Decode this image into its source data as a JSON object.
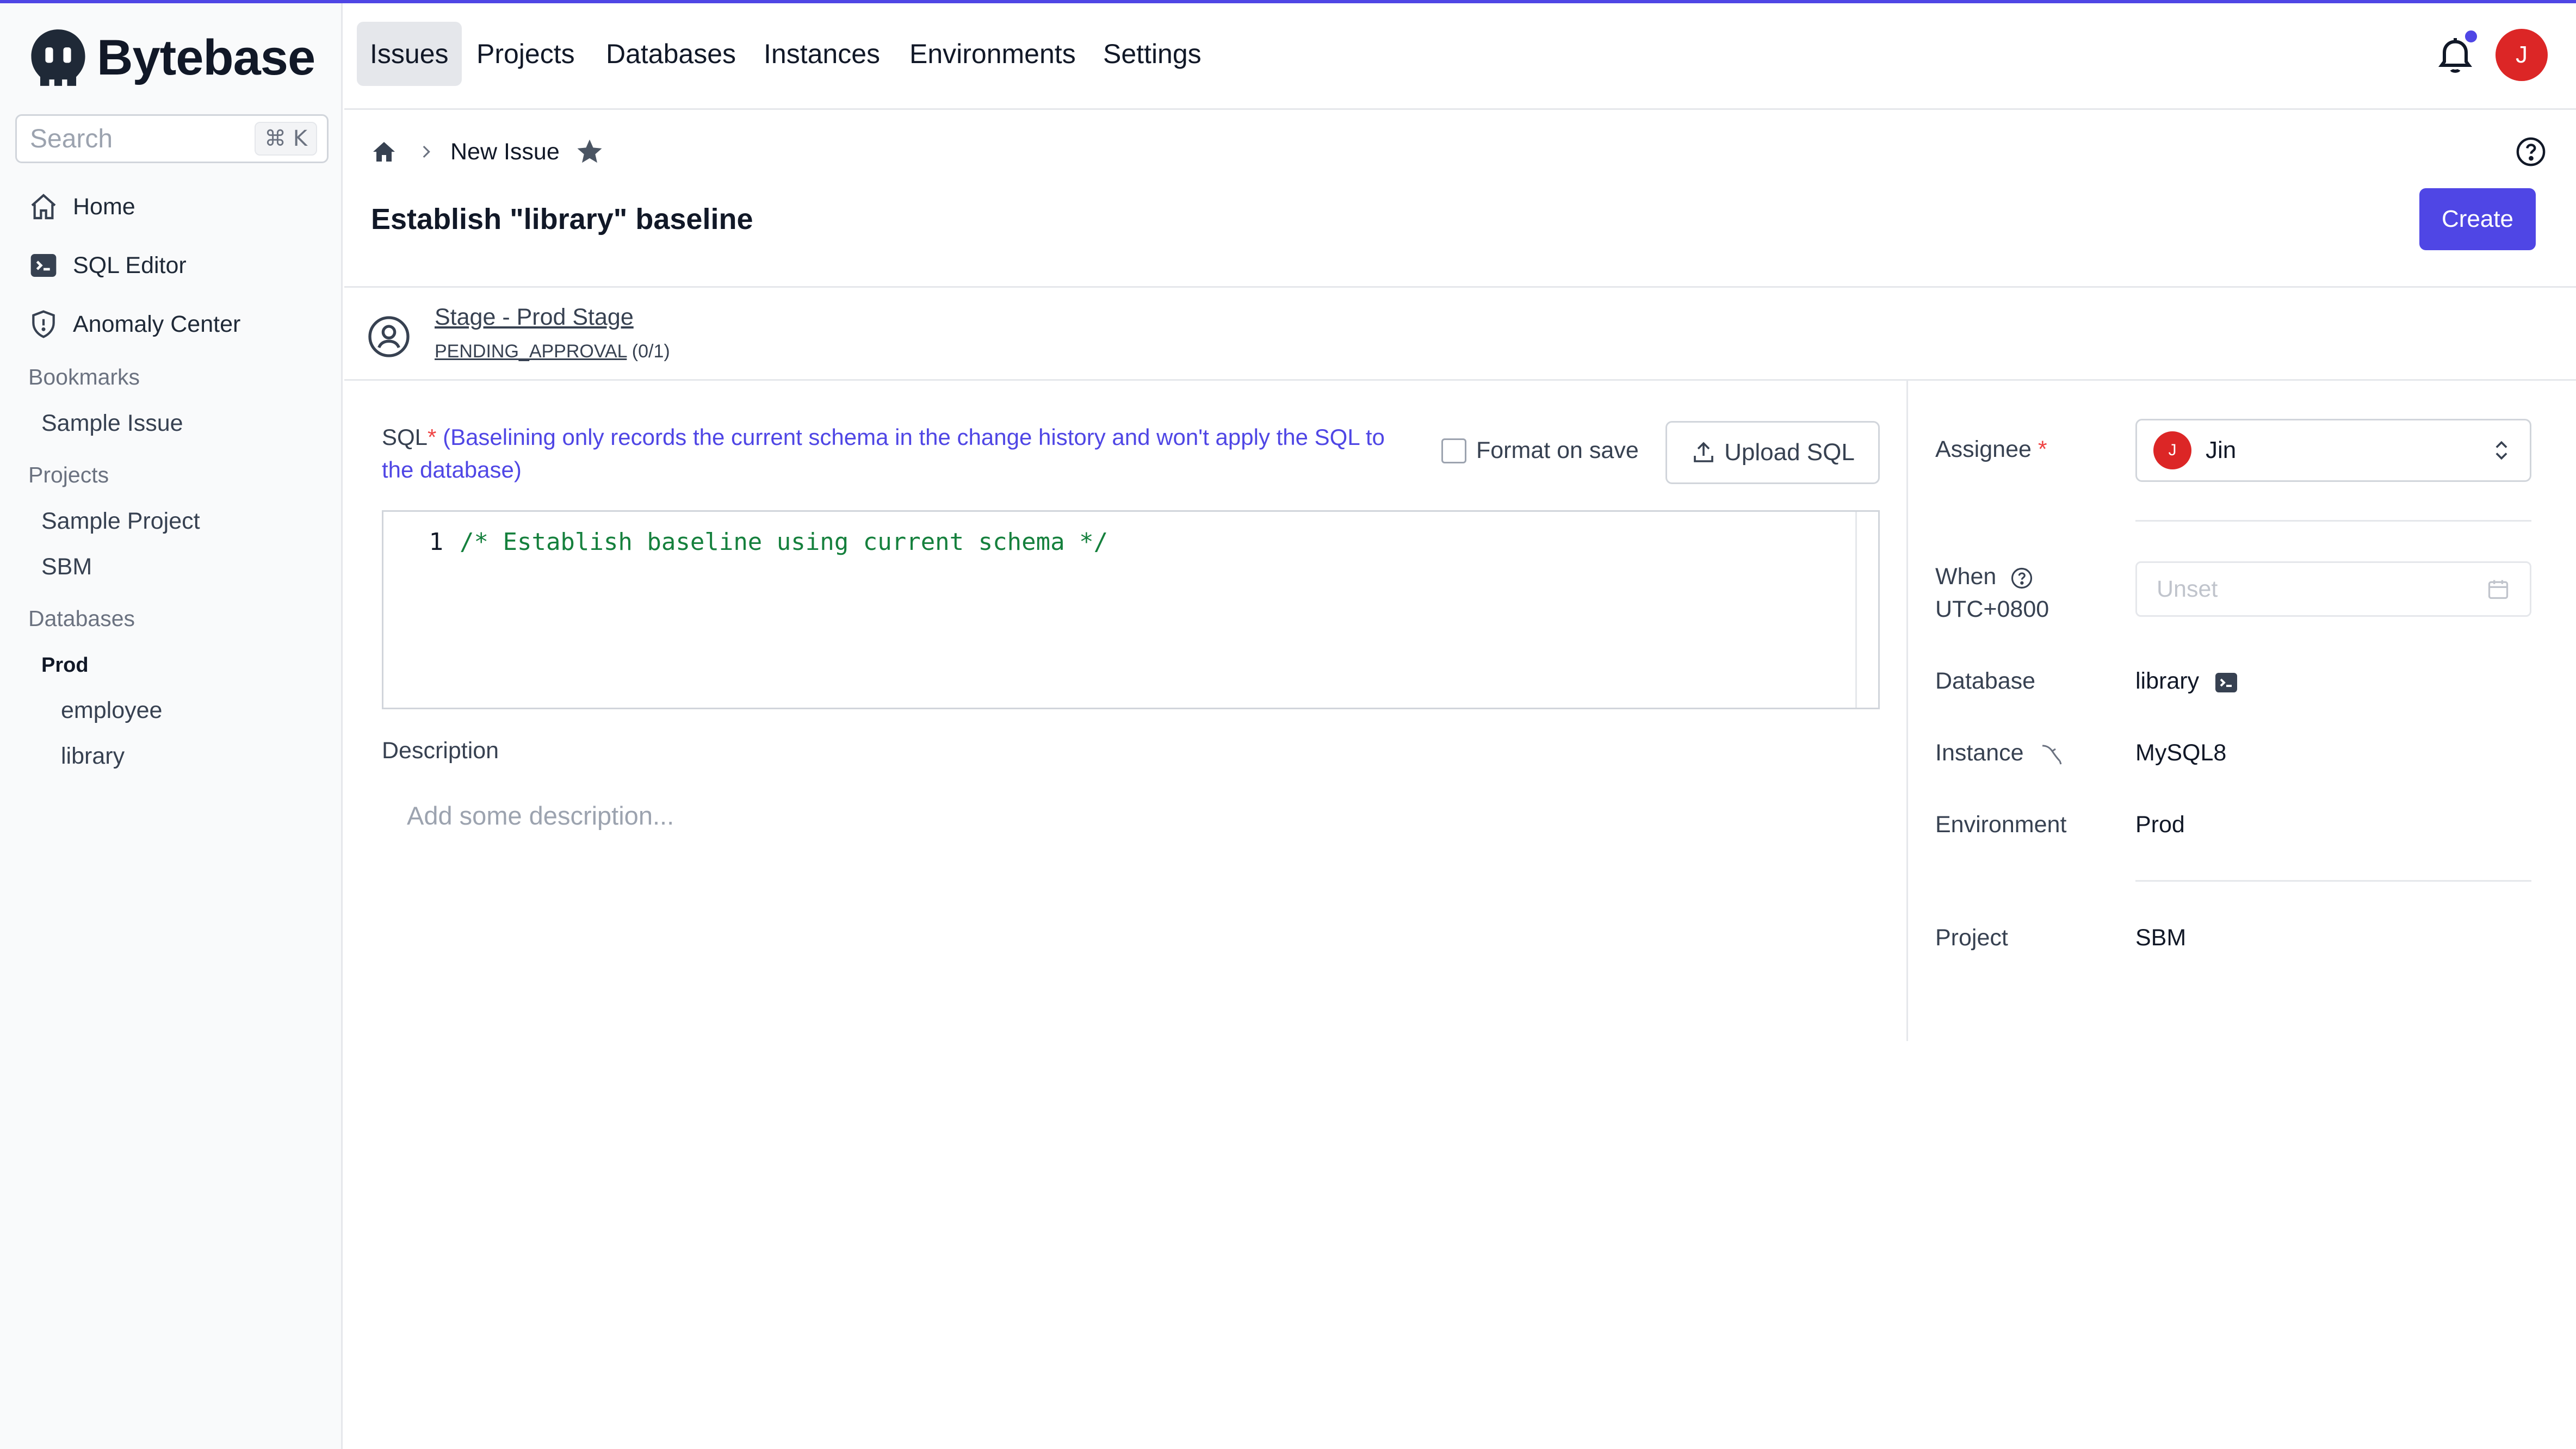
{
  "app": {
    "name": "Bytebase"
  },
  "colors": {
    "accent": "#4f46e5",
    "avatar": "#dc2626",
    "code": "#15803d"
  },
  "search": {
    "placeholder": "Search",
    "shortcut": "⌘ K"
  },
  "sidebar": {
    "nav": [
      {
        "label": "Home",
        "icon": "home-icon"
      },
      {
        "label": "SQL Editor",
        "icon": "terminal-icon"
      },
      {
        "label": "Anomaly Center",
        "icon": "shield-icon"
      }
    ],
    "bookmarks": {
      "title": "Bookmarks",
      "items": [
        "Sample Issue"
      ]
    },
    "projects": {
      "title": "Projects",
      "items": [
        "Sample Project",
        "SBM"
      ]
    },
    "databases": {
      "title": "Databases",
      "env": "Prod",
      "items": [
        "employee",
        "library"
      ]
    }
  },
  "topnav": {
    "tabs": [
      "Issues",
      "Projects",
      "Databases",
      "Instances",
      "Environments",
      "Settings"
    ],
    "active": "Issues",
    "user_initial": "J"
  },
  "breadcrumb": {
    "current": "New Issue"
  },
  "page": {
    "title": "Establish \"library\" baseline",
    "create_label": "Create"
  },
  "stage": {
    "name": "Stage - Prod Stage",
    "status": "PENDING_APPROVAL",
    "progress": "(0/1)"
  },
  "sql": {
    "label": "SQL",
    "required_mark": "*",
    "hint": "(Baselining only records the current schema in the change history and won't apply the SQL to the database)",
    "format_on_save_label": "Format on save",
    "format_on_save": false,
    "upload_label": "Upload SQL",
    "line_number": "1",
    "code": "/* Establish baseline using current schema */"
  },
  "description": {
    "label": "Description",
    "placeholder": "Add some description..."
  },
  "panel": {
    "assignee_label": "Assignee",
    "required_mark": "*",
    "assignee_initial": "J",
    "assignee_name": "Jin",
    "when_label": "When",
    "when_tz": "UTC+0800",
    "when_placeholder": "Unset",
    "database_label": "Database",
    "database_value": "library",
    "instance_label": "Instance",
    "instance_value": "MySQL8",
    "environment_label": "Environment",
    "environment_value": "Prod",
    "project_label": "Project",
    "project_value": "SBM"
  }
}
